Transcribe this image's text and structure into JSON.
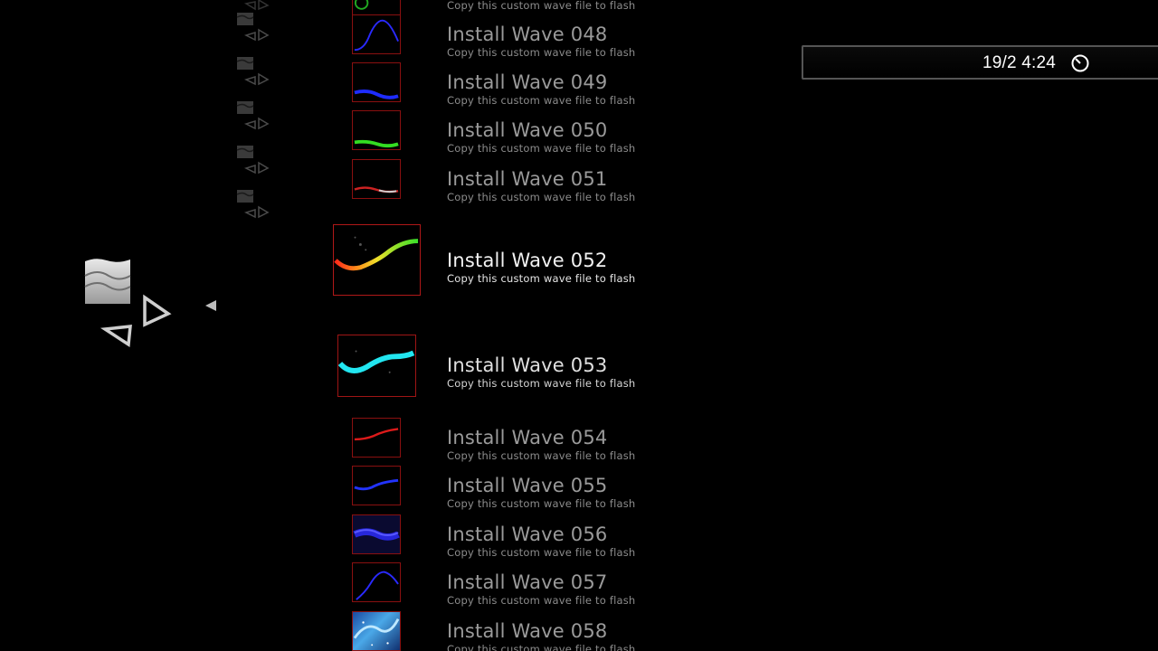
{
  "clock": {
    "time": "19/2 4:24",
    "icon": "clock-icon"
  },
  "category": {
    "icon": "wave-settings-icon",
    "arrow_icon": "left-pointer-icon"
  },
  "side_icons": [
    "wave-settings-icon",
    "wave-settings-icon",
    "wave-settings-icon",
    "wave-settings-icon",
    "wave-settings-icon",
    "wave-settings-icon"
  ],
  "items": [
    {
      "title": "",
      "subtitle": "Copy this custom wave file to flash",
      "wave_color": "#22aa22"
    },
    {
      "title": "Install Wave 048",
      "subtitle": "Copy this custom wave file to flash",
      "wave_color": "#2a2aff"
    },
    {
      "title": "Install Wave 049",
      "subtitle": "Copy this custom wave file to flash",
      "wave_color": "#1e2cff"
    },
    {
      "title": "Install Wave 050",
      "subtitle": "Copy this custom wave file to flash",
      "wave_color": "#33dd22"
    },
    {
      "title": "Install Wave 051",
      "subtitle": "Copy this custom wave file to flash",
      "wave_color": "#cc2222"
    },
    {
      "title": "Install Wave 052",
      "subtitle": "Copy this custom wave file to flash",
      "wave_color": "rainbow"
    },
    {
      "title": "Install Wave 053",
      "subtitle": "Copy this custom wave file to flash",
      "wave_color": "#22e6f0"
    },
    {
      "title": "Install Wave 054",
      "subtitle": "Copy this custom wave file to flash",
      "wave_color": "#dd1a1a"
    },
    {
      "title": "Install Wave 055",
      "subtitle": "Copy this custom wave file to flash",
      "wave_color": "#2233ff"
    },
    {
      "title": "Install Wave 056",
      "subtitle": "Copy this custom wave file to flash",
      "wave_color": "#2a2aee"
    },
    {
      "title": "Install Wave 057",
      "subtitle": "Copy this custom wave file to flash",
      "wave_color": "#2a2aff"
    },
    {
      "title": "Install Wave 058",
      "subtitle": "Copy this custom wave file to flash",
      "wave_color": "#4aa8e8"
    }
  ]
}
